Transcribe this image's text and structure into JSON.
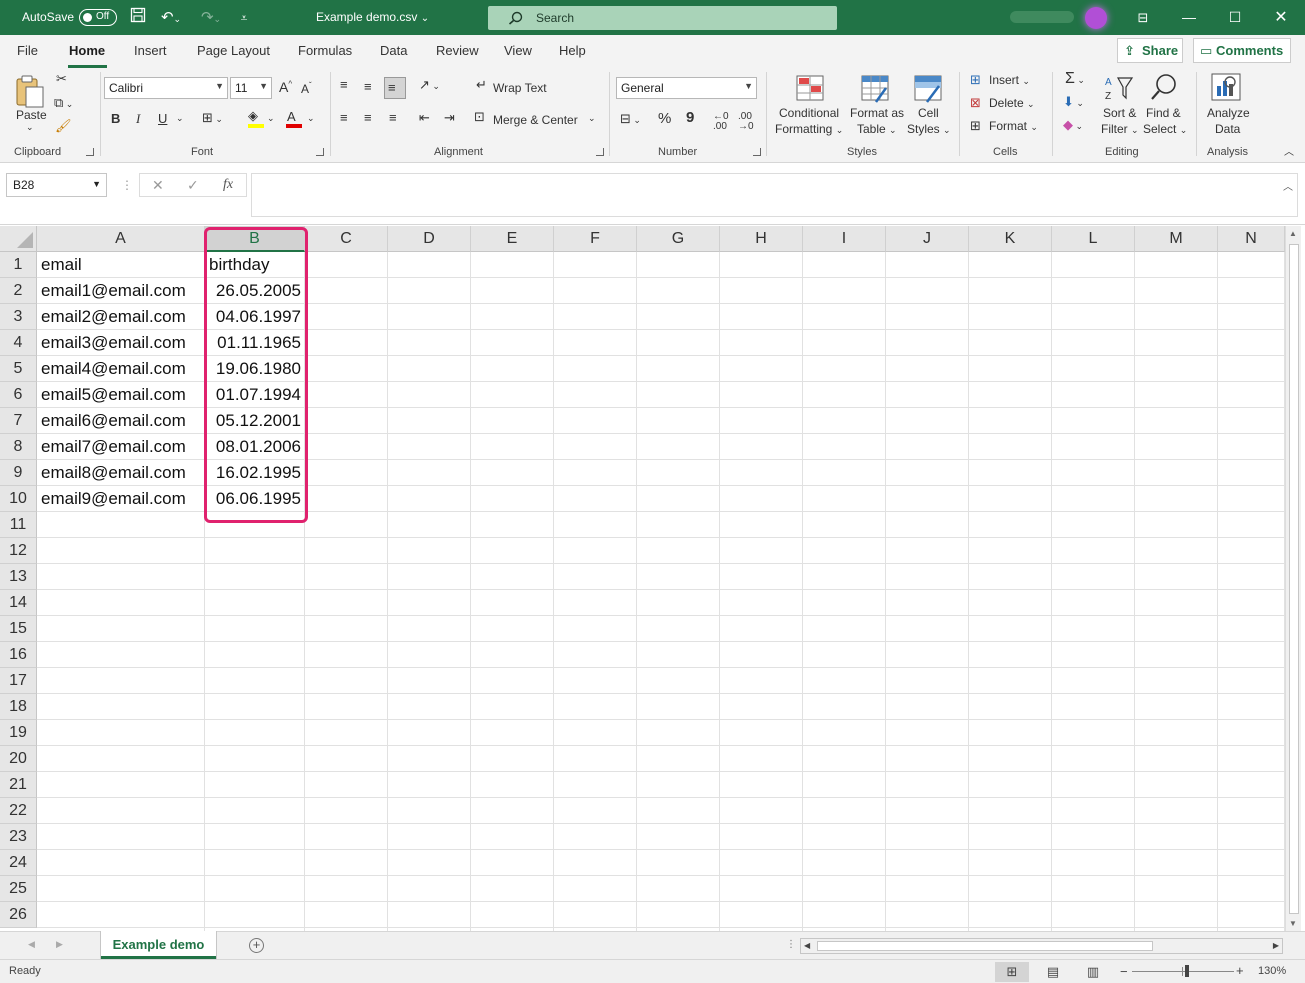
{
  "titlebar": {
    "autosave_label": "AutoSave",
    "autosave_state": "Off",
    "document_title": "Example demo.csv",
    "title_caret": "⌄",
    "search_placeholder": "Search",
    "accent_color": "#217346"
  },
  "ribbon_tabs": [
    "File",
    "Home",
    "Insert",
    "Page Layout",
    "Formulas",
    "Data",
    "Review",
    "View",
    "Help"
  ],
  "active_tab": "Home",
  "share_label": "Share",
  "comments_label": "Comments",
  "ribbon": {
    "clipboard": {
      "paste": "Paste",
      "group": "Clipboard"
    },
    "font": {
      "name": "Calibri",
      "size": "11",
      "bold": "B",
      "italic": "I",
      "underline": "U",
      "group": "Font"
    },
    "alignment": {
      "wrap": "Wrap Text",
      "merge": "Merge & Center",
      "group": "Alignment"
    },
    "number": {
      "format": "General",
      "percent": "%",
      "comma": "9",
      "group": "Number"
    },
    "styles": {
      "cond_1": "Conditional",
      "cond_2": "Formatting",
      "fmt_1": "Format as",
      "fmt_2": "Table",
      "cell_1": "Cell",
      "cell_2": "Styles",
      "group": "Styles"
    },
    "cells": {
      "insert": "Insert",
      "delete": "Delete",
      "format": "Format",
      "group": "Cells"
    },
    "editing": {
      "sort_1": "Sort &",
      "sort_2": "Filter",
      "find_1": "Find &",
      "find_2": "Select",
      "group": "Editing"
    },
    "analysis": {
      "analyze_1": "Analyze",
      "analyze_2": "Data",
      "group": "Analysis"
    }
  },
  "formula_bar": {
    "name_box": "B28",
    "fx": "fx",
    "content": ""
  },
  "columns": [
    {
      "label": "A",
      "selected": false
    },
    {
      "label": "B",
      "selected": true
    },
    {
      "label": "C",
      "selected": false
    },
    {
      "label": "D",
      "selected": false
    },
    {
      "label": "E",
      "selected": false
    },
    {
      "label": "F",
      "selected": false
    },
    {
      "label": "G",
      "selected": false
    },
    {
      "label": "H",
      "selected": false
    },
    {
      "label": "I",
      "selected": false
    },
    {
      "label": "J",
      "selected": false
    },
    {
      "label": "K",
      "selected": false
    },
    {
      "label": "L",
      "selected": false
    },
    {
      "label": "M",
      "selected": false
    },
    {
      "label": "N",
      "selected": false
    }
  ],
  "row_count": 26,
  "cells": [
    [
      "email",
      "birthday"
    ],
    [
      "email1@email.com",
      "26.05.2005"
    ],
    [
      "email2@email.com",
      "04.06.1997"
    ],
    [
      "email3@email.com",
      "01.11.1965"
    ],
    [
      "email4@email.com",
      "19.06.1980"
    ],
    [
      "email5@email.com",
      "01.07.1994"
    ],
    [
      "email6@email.com",
      "05.12.2001"
    ],
    [
      "email7@email.com",
      "08.01.2006"
    ],
    [
      "email8@email.com",
      "16.02.1995"
    ],
    [
      "email9@email.com",
      "06.06.1995"
    ]
  ],
  "highlight_color": "#e0226e",
  "sheet_tab": "Example demo",
  "status": "Ready",
  "zoom": "130%"
}
